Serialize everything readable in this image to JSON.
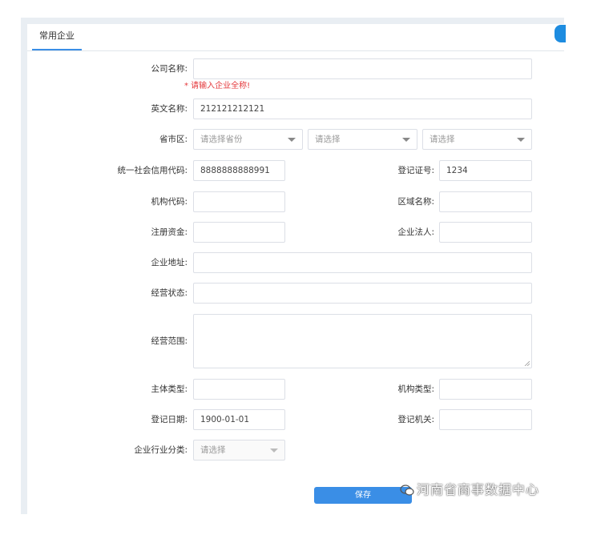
{
  "tabs": [
    {
      "label": "常用企业"
    }
  ],
  "form": {
    "company_name": {
      "label": "公司名称:",
      "value": "",
      "error": "*  请输入企业全称!"
    },
    "english_name": {
      "label": "英文名称:",
      "value": "212121212121"
    },
    "region": {
      "label": "省市区:",
      "province": {
        "placeholder": "请选择省份"
      },
      "city": {
        "placeholder": "请选择"
      },
      "district": {
        "placeholder": "请选择"
      }
    },
    "credit_code": {
      "label": "统一社会信用代码:",
      "value": "8888888888991"
    },
    "register_no": {
      "label": "登记证号:",
      "value": "1234"
    },
    "org_code": {
      "label": "机构代码:",
      "value": ""
    },
    "area_name": {
      "label": "区域名称:",
      "value": ""
    },
    "reg_capital": {
      "label": "注册资金:",
      "value": ""
    },
    "legal_person": {
      "label": "企业法人:",
      "value": ""
    },
    "address": {
      "label": "企业地址:",
      "value": ""
    },
    "biz_status": {
      "label": "经营状态:",
      "value": ""
    },
    "biz_scope": {
      "label": "经营范围:",
      "value": ""
    },
    "entity_type": {
      "label": "主体类型:",
      "value": ""
    },
    "org_type": {
      "label": "机构类型:",
      "value": ""
    },
    "reg_date": {
      "label": "登记日期:",
      "value": "1900-01-01"
    },
    "reg_authority": {
      "label": "登记机关:",
      "value": ""
    },
    "industry": {
      "label": "企业行业分类:",
      "placeholder": "请选择"
    }
  },
  "actions": {
    "save_label": "保存"
  },
  "watermark": {
    "text": "河南省商事数据中心"
  },
  "colors": {
    "accent": "#3a8ee6",
    "error": "#e4393c"
  }
}
